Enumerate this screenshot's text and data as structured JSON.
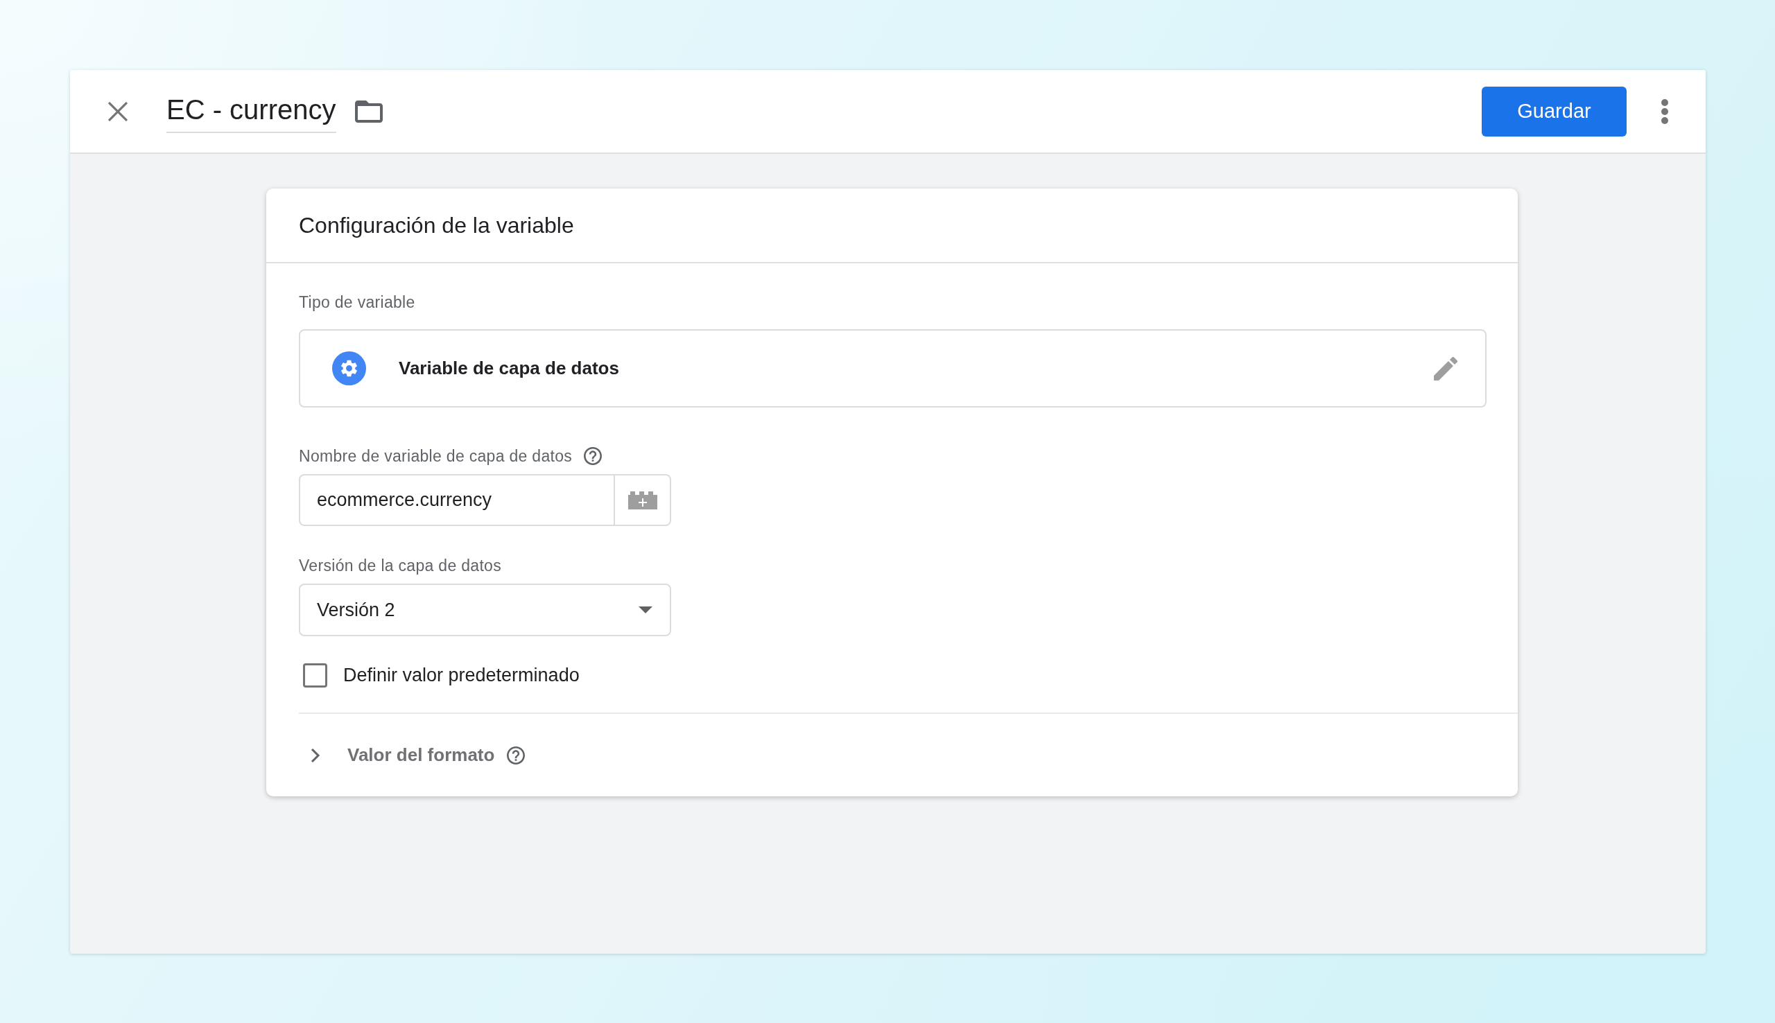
{
  "window": {
    "title": "EC - currency",
    "save_button": "Guardar"
  },
  "card": {
    "title": "Configuración de la variable",
    "variable_type": {
      "label": "Tipo de variable",
      "value": "Variable de capa de datos"
    },
    "fields": [
      {
        "kind": "text",
        "label": "Nombre de variable de capa de datos",
        "help": true,
        "value": "ecommerce.currency"
      },
      {
        "kind": "select",
        "label": "Versión de la capa de datos",
        "help": false,
        "value": "Versión 2"
      }
    ],
    "default_value": {
      "label": "Definir valor predeterminado",
      "checked": false
    },
    "format_section": {
      "label": "Valor del formato",
      "help": true,
      "expanded": false
    }
  }
}
